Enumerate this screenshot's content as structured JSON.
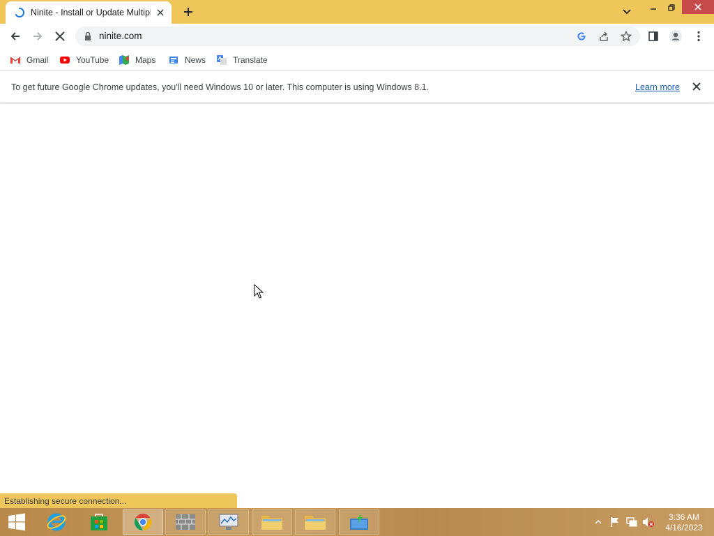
{
  "browser": {
    "tab": {
      "title": "Ninite - Install or Update Multiple Apps at Once",
      "spinner_color": "#1a73e8"
    },
    "window_controls": [
      "minimize",
      "restore",
      "close"
    ],
    "accent": "#efc65a",
    "toolbar": {
      "back_icon": "arrow-left-icon",
      "forward_icon": "arrow-right-icon",
      "stop_icon": "stop-loading-icon",
      "url": "ninite.com"
    },
    "bookmarks": [
      {
        "label": "Gmail",
        "icon": "gmail-icon"
      },
      {
        "label": "YouTube",
        "icon": "youtube-icon"
      },
      {
        "label": "Maps",
        "icon": "maps-icon"
      },
      {
        "label": "News",
        "icon": "news-icon"
      },
      {
        "label": "Translate",
        "icon": "translate-icon"
      }
    ],
    "infobar": {
      "message": "To get future Google Chrome updates, you'll need Windows 10 or later. This computer is using Windows 8.1.",
      "link": "Learn more"
    },
    "status": "Establishing secure connection..."
  },
  "taskbar": {
    "apps": [
      {
        "name": "start",
        "icon": "windows-logo-icon"
      },
      {
        "name": "internet-explorer",
        "icon": "ie-icon"
      },
      {
        "name": "store",
        "icon": "store-icon"
      },
      {
        "name": "chrome",
        "icon": "chrome-icon"
      },
      {
        "name": "firewall",
        "icon": "firewall-icon"
      },
      {
        "name": "monitor",
        "icon": "monitor-icon"
      },
      {
        "name": "explorer-1",
        "icon": "folder-icon"
      },
      {
        "name": "explorer-2",
        "icon": "folder-icon"
      },
      {
        "name": "installer",
        "icon": "install-icon"
      }
    ],
    "clock": {
      "time": "3:36 AM",
      "date": "4/16/2023"
    }
  }
}
